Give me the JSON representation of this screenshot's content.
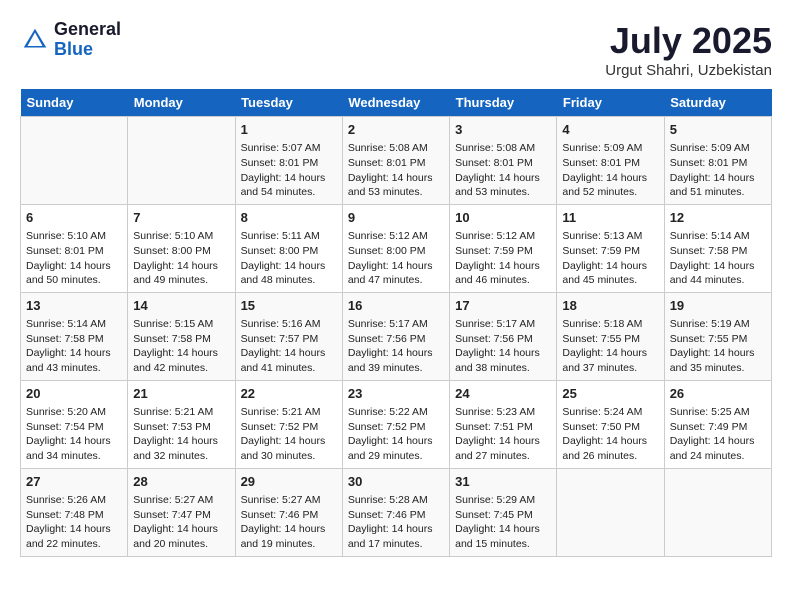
{
  "logo": {
    "general": "General",
    "blue": "Blue"
  },
  "title": "July 2025",
  "location": "Urgut Shahri, Uzbekistan",
  "weekdays": [
    "Sunday",
    "Monday",
    "Tuesday",
    "Wednesday",
    "Thursday",
    "Friday",
    "Saturday"
  ],
  "weeks": [
    [
      {
        "day": "",
        "info": ""
      },
      {
        "day": "",
        "info": ""
      },
      {
        "day": "1",
        "info": "Sunrise: 5:07 AM\nSunset: 8:01 PM\nDaylight: 14 hours and 54 minutes."
      },
      {
        "day": "2",
        "info": "Sunrise: 5:08 AM\nSunset: 8:01 PM\nDaylight: 14 hours and 53 minutes."
      },
      {
        "day": "3",
        "info": "Sunrise: 5:08 AM\nSunset: 8:01 PM\nDaylight: 14 hours and 53 minutes."
      },
      {
        "day": "4",
        "info": "Sunrise: 5:09 AM\nSunset: 8:01 PM\nDaylight: 14 hours and 52 minutes."
      },
      {
        "day": "5",
        "info": "Sunrise: 5:09 AM\nSunset: 8:01 PM\nDaylight: 14 hours and 51 minutes."
      }
    ],
    [
      {
        "day": "6",
        "info": "Sunrise: 5:10 AM\nSunset: 8:01 PM\nDaylight: 14 hours and 50 minutes."
      },
      {
        "day": "7",
        "info": "Sunrise: 5:10 AM\nSunset: 8:00 PM\nDaylight: 14 hours and 49 minutes."
      },
      {
        "day": "8",
        "info": "Sunrise: 5:11 AM\nSunset: 8:00 PM\nDaylight: 14 hours and 48 minutes."
      },
      {
        "day": "9",
        "info": "Sunrise: 5:12 AM\nSunset: 8:00 PM\nDaylight: 14 hours and 47 minutes."
      },
      {
        "day": "10",
        "info": "Sunrise: 5:12 AM\nSunset: 7:59 PM\nDaylight: 14 hours and 46 minutes."
      },
      {
        "day": "11",
        "info": "Sunrise: 5:13 AM\nSunset: 7:59 PM\nDaylight: 14 hours and 45 minutes."
      },
      {
        "day": "12",
        "info": "Sunrise: 5:14 AM\nSunset: 7:58 PM\nDaylight: 14 hours and 44 minutes."
      }
    ],
    [
      {
        "day": "13",
        "info": "Sunrise: 5:14 AM\nSunset: 7:58 PM\nDaylight: 14 hours and 43 minutes."
      },
      {
        "day": "14",
        "info": "Sunrise: 5:15 AM\nSunset: 7:58 PM\nDaylight: 14 hours and 42 minutes."
      },
      {
        "day": "15",
        "info": "Sunrise: 5:16 AM\nSunset: 7:57 PM\nDaylight: 14 hours and 41 minutes."
      },
      {
        "day": "16",
        "info": "Sunrise: 5:17 AM\nSunset: 7:56 PM\nDaylight: 14 hours and 39 minutes."
      },
      {
        "day": "17",
        "info": "Sunrise: 5:17 AM\nSunset: 7:56 PM\nDaylight: 14 hours and 38 minutes."
      },
      {
        "day": "18",
        "info": "Sunrise: 5:18 AM\nSunset: 7:55 PM\nDaylight: 14 hours and 37 minutes."
      },
      {
        "day": "19",
        "info": "Sunrise: 5:19 AM\nSunset: 7:55 PM\nDaylight: 14 hours and 35 minutes."
      }
    ],
    [
      {
        "day": "20",
        "info": "Sunrise: 5:20 AM\nSunset: 7:54 PM\nDaylight: 14 hours and 34 minutes."
      },
      {
        "day": "21",
        "info": "Sunrise: 5:21 AM\nSunset: 7:53 PM\nDaylight: 14 hours and 32 minutes."
      },
      {
        "day": "22",
        "info": "Sunrise: 5:21 AM\nSunset: 7:52 PM\nDaylight: 14 hours and 30 minutes."
      },
      {
        "day": "23",
        "info": "Sunrise: 5:22 AM\nSunset: 7:52 PM\nDaylight: 14 hours and 29 minutes."
      },
      {
        "day": "24",
        "info": "Sunrise: 5:23 AM\nSunset: 7:51 PM\nDaylight: 14 hours and 27 minutes."
      },
      {
        "day": "25",
        "info": "Sunrise: 5:24 AM\nSunset: 7:50 PM\nDaylight: 14 hours and 26 minutes."
      },
      {
        "day": "26",
        "info": "Sunrise: 5:25 AM\nSunset: 7:49 PM\nDaylight: 14 hours and 24 minutes."
      }
    ],
    [
      {
        "day": "27",
        "info": "Sunrise: 5:26 AM\nSunset: 7:48 PM\nDaylight: 14 hours and 22 minutes."
      },
      {
        "day": "28",
        "info": "Sunrise: 5:27 AM\nSunset: 7:47 PM\nDaylight: 14 hours and 20 minutes."
      },
      {
        "day": "29",
        "info": "Sunrise: 5:27 AM\nSunset: 7:46 PM\nDaylight: 14 hours and 19 minutes."
      },
      {
        "day": "30",
        "info": "Sunrise: 5:28 AM\nSunset: 7:46 PM\nDaylight: 14 hours and 17 minutes."
      },
      {
        "day": "31",
        "info": "Sunrise: 5:29 AM\nSunset: 7:45 PM\nDaylight: 14 hours and 15 minutes."
      },
      {
        "day": "",
        "info": ""
      },
      {
        "day": "",
        "info": ""
      }
    ]
  ]
}
